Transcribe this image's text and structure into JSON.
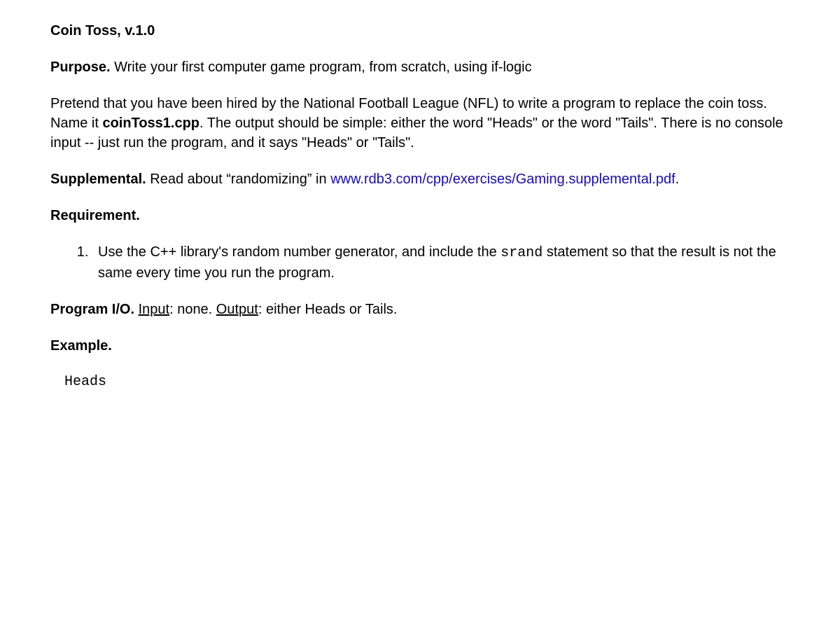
{
  "title": "Coin Toss, v.1.0",
  "purpose": {
    "label": "Purpose.",
    "text": " Write your first computer game program, from scratch, using if-logic"
  },
  "scenario": {
    "part1": "Pretend that you have been hired by the National Football League (NFL) to write a program to replace the coin toss. Name it ",
    "filename": "coinToss1.cpp",
    "part2": ". The output should be simple: either the word \"Heads\" or the word \"Tails\". There is no console input  -- just run the program, and it says \"Heads\" or \"Tails\"."
  },
  "supplemental": {
    "label": "Supplemental.",
    "text": " Read about “randomizing” in ",
    "link": "www.rdb3.com/cpp/exercises/Gaming.supplemental.pdf",
    "after": "."
  },
  "requirement": {
    "label": "Requirement.",
    "item1_part1": "Use the C++ library's random number generator, and include the ",
    "item1_code": "srand",
    "item1_part2": " statement so that the result is not the same every time you run the program."
  },
  "io": {
    "label": "Program I/O.",
    "inputLabel": "Input",
    "inputText": ": none. ",
    "outputLabel": "Output",
    "outputText": ": either Heads or Tails."
  },
  "example": {
    "label": "Example.",
    "output": "Heads"
  }
}
